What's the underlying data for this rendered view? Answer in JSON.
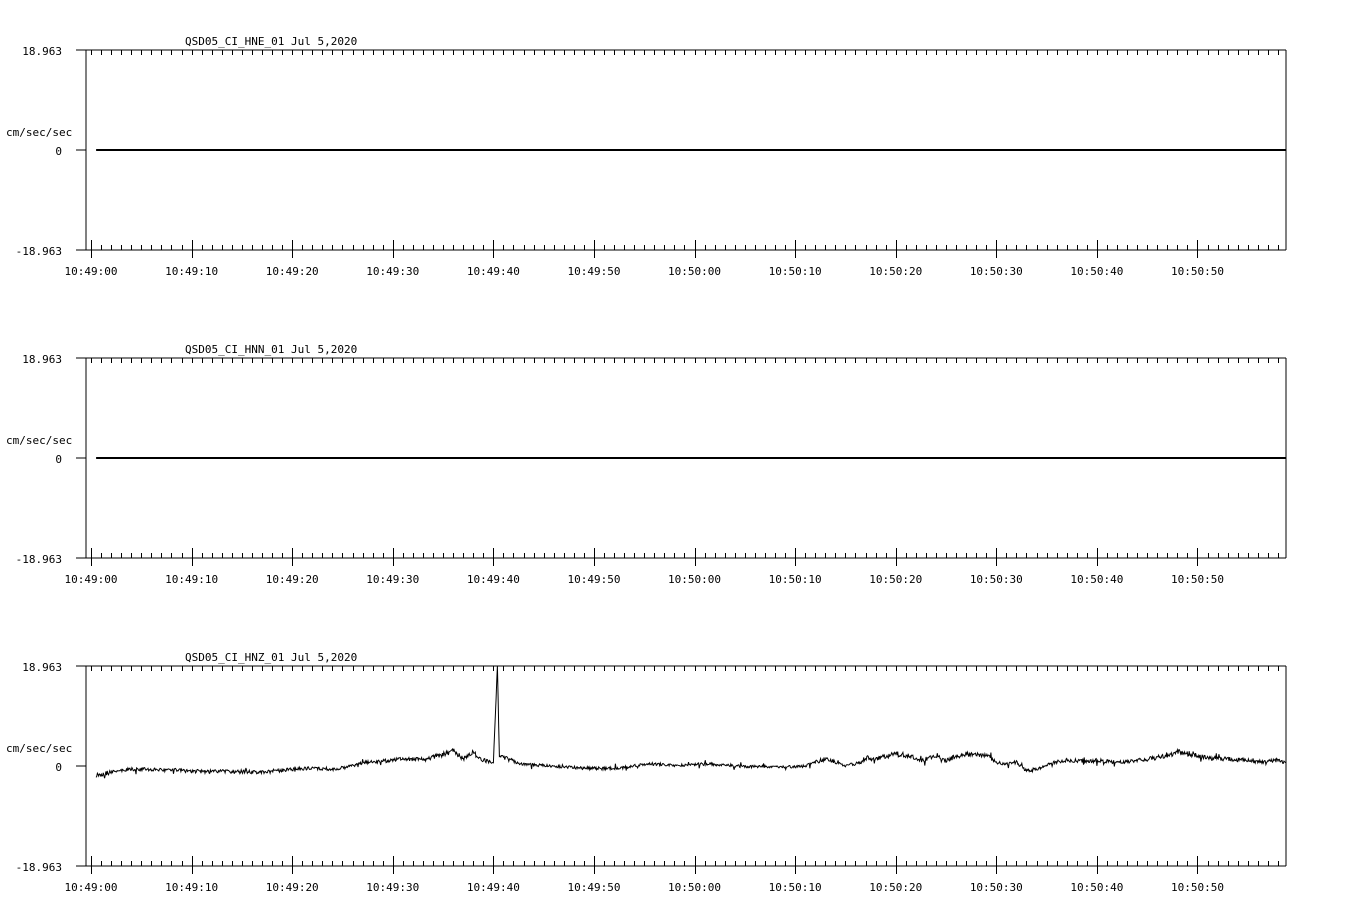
{
  "chart_data": [
    {
      "type": "line",
      "title": "QSD05_CI_HNE_01  Jul 5,2020",
      "ylabel": "cm/sec/sec",
      "ylim": [
        -18.963,
        18.963
      ],
      "y_tick_labels": [
        "18.963",
        "0",
        "-18.963"
      ],
      "x_tick_labels": [
        "10:49:00",
        "10:49:10",
        "10:49:20",
        "10:49:30",
        "10:49:40",
        "10:49:50",
        "10:50:00",
        "10:50:10",
        "10:50:20",
        "10:50:30",
        "10:50:40",
        "10:50:50"
      ],
      "xlim_seconds": [
        -0.5,
        118.8
      ],
      "grid": false,
      "series": [
        {
          "x_seconds": [
            0.5,
            118.8
          ],
          "values": [
            0,
            0
          ]
        }
      ]
    },
    {
      "type": "line",
      "title": "QSD05_CI_HNN_01  Jul 5,2020",
      "ylabel": "cm/sec/sec",
      "ylim": [
        -18.963,
        18.963
      ],
      "y_tick_labels": [
        "18.963",
        "0",
        "-18.963"
      ],
      "x_tick_labels": [
        "10:49:00",
        "10:49:10",
        "10:49:20",
        "10:49:30",
        "10:49:40",
        "10:49:50",
        "10:50:00",
        "10:50:10",
        "10:50:20",
        "10:50:30",
        "10:50:40",
        "10:50:50"
      ],
      "xlim_seconds": [
        -0.5,
        118.8
      ],
      "grid": false,
      "series": [
        {
          "x_seconds": [
            0.5,
            118.8
          ],
          "values": [
            0,
            0
          ]
        }
      ]
    },
    {
      "type": "line",
      "title": "QSD05_CI_HNZ_01  Jul 5,2020",
      "ylabel": "cm/sec/sec",
      "ylim": [
        -18.963,
        18.963
      ],
      "y_tick_labels": [
        "18.963",
        "0",
        "-18.963"
      ],
      "x_tick_labels": [
        "10:49:00",
        "10:49:10",
        "10:49:20",
        "10:49:30",
        "10:49:40",
        "10:49:50",
        "10:50:00",
        "10:50:10",
        "10:50:20",
        "10:50:30",
        "10:50:40",
        "10:50:50"
      ],
      "xlim_seconds": [
        -0.5,
        118.8
      ],
      "grid": false,
      "series": [
        {
          "x_seconds": [
            0.5,
            2,
            4,
            6,
            8,
            10,
            12,
            14,
            16,
            18,
            20,
            22,
            24,
            25.5,
            27,
            29,
            31,
            33,
            35,
            36,
            37,
            38,
            39,
            40,
            40.4,
            40.6,
            41,
            42,
            43,
            45,
            47,
            49,
            51,
            53,
            55,
            57,
            59,
            61,
            63,
            65,
            67,
            69,
            71,
            73,
            75,
            76.5,
            77,
            78,
            80,
            81.5,
            82.5,
            84,
            85,
            86,
            87,
            88,
            89,
            90,
            91,
            92,
            93,
            94,
            94.5,
            96,
            97,
            98,
            99,
            100,
            102,
            104,
            106,
            108,
            109.5,
            110,
            111,
            112,
            114,
            116,
            118,
            118.8
          ],
          "values": [
            -1.7,
            -1.2,
            -0.6,
            -0.6,
            -0.7,
            -1.0,
            -1.1,
            -1.0,
            -1.2,
            -1.0,
            -0.6,
            -0.4,
            -0.6,
            -0.2,
            0.6,
            0.9,
            1.3,
            1.2,
            2.2,
            2.9,
            1.3,
            2.6,
            1.1,
            0.6,
            18.963,
            1.5,
            1.6,
            0.9,
            0.3,
            0.1,
            -0.2,
            -0.4,
            -0.5,
            -0.3,
            0.4,
            0.3,
            0.1,
            0.4,
            0.2,
            -0.1,
            -0.1,
            -0.2,
            0.0,
            1.4,
            0.1,
            0.6,
            1.6,
            1.3,
            2.3,
            1.9,
            0.9,
            2.1,
            1.0,
            1.9,
            2.2,
            2.2,
            2.2,
            0.6,
            0.4,
            0.7,
            -0.9,
            -0.6,
            -0.2,
            0.8,
            1.1,
            1.0,
            0.8,
            1.1,
            0.7,
            1.0,
            1.6,
            2.6,
            2.3,
            1.9,
            1.5,
            1.4,
            1.2,
            0.8,
            1.1,
            0.6
          ]
        }
      ]
    }
  ]
}
